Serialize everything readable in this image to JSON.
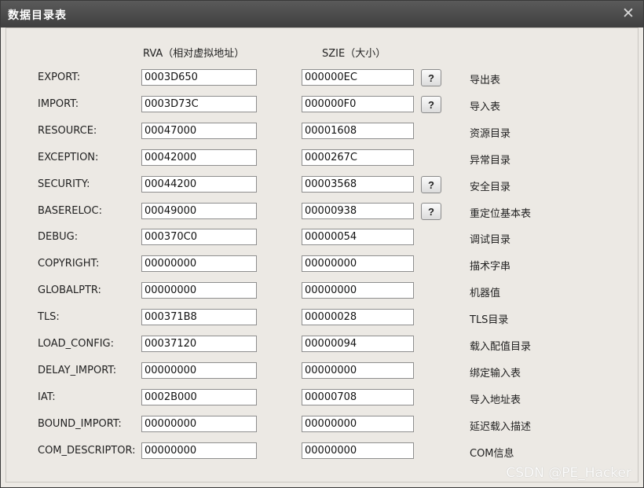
{
  "window": {
    "title": "数据目录表"
  },
  "headers": {
    "rva": "RVA（相对虚拟地址）",
    "size": "SZIE（大小）"
  },
  "help_label": "?",
  "rows": [
    {
      "name": "EXPORT:",
      "rva": "0003D650",
      "size": "000000EC",
      "help": true,
      "desc": "导出表"
    },
    {
      "name": "IMPORT:",
      "rva": "0003D73C",
      "size": "000000F0",
      "help": true,
      "desc": "导入表"
    },
    {
      "name": "RESOURCE:",
      "rva": "00047000",
      "size": "00001608",
      "help": false,
      "desc": "资源目录"
    },
    {
      "name": "EXCEPTION:",
      "rva": "00042000",
      "size": "0000267C",
      "help": false,
      "desc": "异常目录"
    },
    {
      "name": "SECURITY:",
      "rva": "00044200",
      "size": "00003568",
      "help": true,
      "desc": "安全目录"
    },
    {
      "name": "BASERELOC:",
      "rva": "00049000",
      "size": "00000938",
      "help": true,
      "desc": "重定位基本表"
    },
    {
      "name": "DEBUG:",
      "rva": "000370C0",
      "size": "00000054",
      "help": false,
      "desc": "调试目录"
    },
    {
      "name": "COPYRIGHT:",
      "rva": "00000000",
      "size": "00000000",
      "help": false,
      "desc": "描术字串"
    },
    {
      "name": "GLOBALPTR:",
      "rva": "00000000",
      "size": "00000000",
      "help": false,
      "desc": "机器值"
    },
    {
      "name": "TLS:",
      "rva": "000371B8",
      "size": "00000028",
      "help": false,
      "desc": "TLS目录"
    },
    {
      "name": "LOAD_CONFIG:",
      "rva": "00037120",
      "size": "00000094",
      "help": false,
      "desc": "载入配值目录"
    },
    {
      "name": "DELAY_IMPORT:",
      "rva": "00000000",
      "size": "00000000",
      "help": false,
      "desc": "绑定输入表"
    },
    {
      "name": "IAT:",
      "rva": "0002B000",
      "size": "00000708",
      "help": false,
      "desc": "导入地址表"
    },
    {
      "name": "BOUND_IMPORT:",
      "rva": "00000000",
      "size": "00000000",
      "help": false,
      "desc": "延迟载入描述"
    },
    {
      "name": "COM_DESCRIPTOR:",
      "rva": "00000000",
      "size": "00000000",
      "help": false,
      "desc": "COM信息"
    }
  ],
  "watermark": "CSDN @PE_Hacker"
}
